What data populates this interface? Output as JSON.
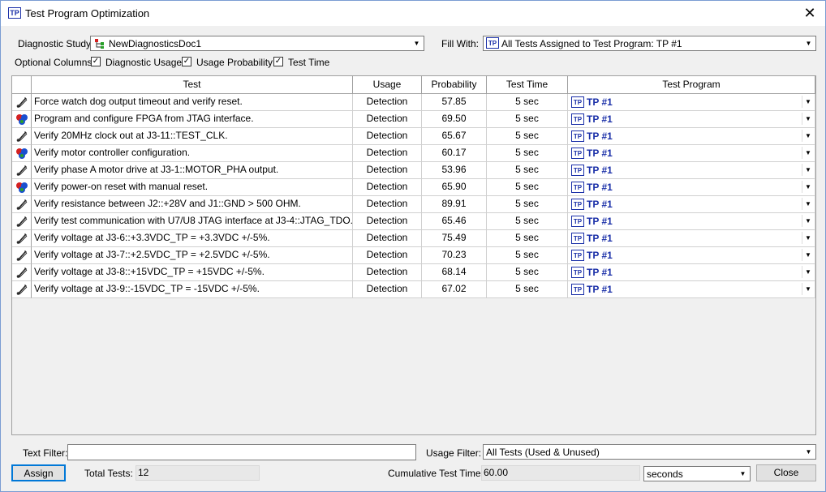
{
  "window": {
    "title": "Test Program Optimization",
    "icon": "TP",
    "close": "✕"
  },
  "top": {
    "study_label": "Diagnostic Study:",
    "study_value": "NewDiagnosticsDoc1",
    "fill_label": "Fill With:",
    "fill_value": "All Tests Assigned to Test Program: TP #1",
    "fill_icon": "TP",
    "optional_label": "Optional Columns:",
    "opt1": "Diagnostic Usage",
    "opt2": "Usage Probability",
    "opt3": "Test Time",
    "check": "✓"
  },
  "columns": {
    "test": "Test",
    "usage": "Usage",
    "probability": "Probability",
    "time": "Test Time",
    "program": "Test Program"
  },
  "rows": [
    {
      "icon": "probe",
      "test": "Force watch dog output timeout and verify reset.",
      "usage": "Detection",
      "prob": "57.85",
      "time": "5 sec",
      "program": "TP #1",
      "badge": "TP"
    },
    {
      "icon": "cluster",
      "test": "Program and configure FPGA from JTAG interface.",
      "usage": "Detection",
      "prob": "69.50",
      "time": "5 sec",
      "program": "TP #1",
      "badge": "TP"
    },
    {
      "icon": "probe",
      "test": "Verify 20MHz clock out at J3-11::TEST_CLK.",
      "usage": "Detection",
      "prob": "65.67",
      "time": "5 sec",
      "program": "TP #1",
      "badge": "TP"
    },
    {
      "icon": "cluster",
      "test": "Verify motor controller configuration.",
      "usage": "Detection",
      "prob": "60.17",
      "time": "5 sec",
      "program": "TP #1",
      "badge": "TP"
    },
    {
      "icon": "probe",
      "test": "Verify phase A motor drive at J3-1::MOTOR_PHA output.",
      "usage": "Detection",
      "prob": "53.96",
      "time": "5 sec",
      "program": "TP #1",
      "badge": "TP"
    },
    {
      "icon": "cluster",
      "test": "Verify power-on reset with manual reset.",
      "usage": "Detection",
      "prob": "65.90",
      "time": "5 sec",
      "program": "TP #1",
      "badge": "TP"
    },
    {
      "icon": "probe",
      "test": "Verify resistance between J2::+28V and J1::GND > 500 OHM.",
      "usage": "Detection",
      "prob": "89.91",
      "time": "5 sec",
      "program": "TP #1",
      "badge": "TP"
    },
    {
      "icon": "probe",
      "test": "Verify test communication with U7/U8 JTAG interface at J3-4::JTAG_TDO.",
      "usage": "Detection",
      "prob": "65.46",
      "time": "5 sec",
      "program": "TP #1",
      "badge": "TP"
    },
    {
      "icon": "probe",
      "test": "Verify voltage at J3-6::+3.3VDC_TP = +3.3VDC +/-5%.",
      "usage": "Detection",
      "prob": "75.49",
      "time": "5 sec",
      "program": "TP #1",
      "badge": "TP"
    },
    {
      "icon": "probe",
      "test": "Verify voltage at J3-7::+2.5VDC_TP = +2.5VDC +/-5%.",
      "usage": "Detection",
      "prob": "70.23",
      "time": "5 sec",
      "program": "TP #1",
      "badge": "TP"
    },
    {
      "icon": "probe",
      "test": "Verify voltage at J3-8::+15VDC_TP = +15VDC +/-5%.",
      "usage": "Detection",
      "prob": "68.14",
      "time": "5 sec",
      "program": "TP #1",
      "badge": "TP"
    },
    {
      "icon": "probe",
      "test": "Verify voltage at J3-9::-15VDC_TP = -15VDC +/-5%.",
      "usage": "Detection",
      "prob": "67.02",
      "time": "5 sec",
      "program": "TP #1",
      "badge": "TP"
    }
  ],
  "bottom": {
    "text_filter_label": "Text Filter:",
    "text_filter_value": "",
    "usage_filter_label": "Usage Filter:",
    "usage_filter_value": "All Tests (Used & Unused)",
    "assign": "Assign",
    "total_label": "Total Tests:",
    "total_value": "12",
    "cum_label": "Cumulative Test Time:",
    "cum_value": "60.00",
    "unit_value": "seconds",
    "close": "Close"
  },
  "arrow": "▼"
}
